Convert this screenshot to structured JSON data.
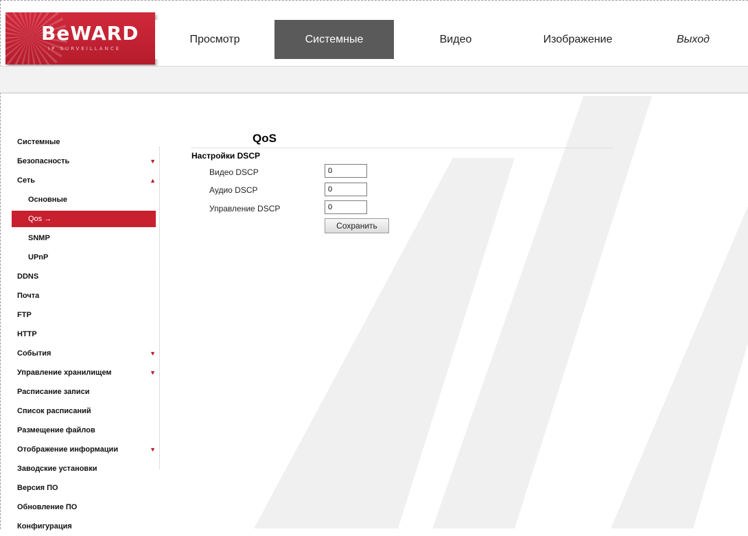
{
  "logo": {
    "main": "BeWARD",
    "sub": "IP SURVEILLANCE"
  },
  "nav": {
    "items": [
      {
        "label": "Просмотр",
        "active": false
      },
      {
        "label": "Системные",
        "active": true
      },
      {
        "label": "Видео",
        "active": false
      },
      {
        "label": "Изображение",
        "active": false
      },
      {
        "label": "Выход",
        "active": false
      }
    ]
  },
  "sidebar": {
    "items": [
      {
        "label": "Системные"
      },
      {
        "label": "Безопасность",
        "arrow": "▼"
      },
      {
        "label": "Сеть",
        "arrow": "▲"
      },
      {
        "label": "Основные"
      },
      {
        "label": "Qos",
        "suffix": "→"
      },
      {
        "label": "SNMP"
      },
      {
        "label": "UPnP"
      },
      {
        "label": "DDNS"
      },
      {
        "label": "Почта"
      },
      {
        "label": "FTP"
      },
      {
        "label": "HTTP"
      },
      {
        "label": "События",
        "arrow": "▼"
      },
      {
        "label": "Управление хранилищем",
        "arrow": "▼"
      },
      {
        "label": "Расписание записи"
      },
      {
        "label": "Список расписаний"
      },
      {
        "label": "Размещение файлов"
      },
      {
        "label": "Отображение информации",
        "arrow": "▼"
      },
      {
        "label": "Заводские установки"
      },
      {
        "label": "Версия ПО"
      },
      {
        "label": "Обновление ПО"
      },
      {
        "label": "Конфигурация"
      }
    ]
  },
  "content": {
    "title": "QoS",
    "section": "Настройки DSCP",
    "fields": [
      {
        "label": "Видео DSCP",
        "value": "0"
      },
      {
        "label": "Аудио DSCP",
        "value": "0"
      },
      {
        "label": "Управление DSCP",
        "value": "0"
      }
    ],
    "save_label": "Сохранить"
  },
  "colors": {
    "brand_red": "#c8202f",
    "active_tab": "#5a5a5a"
  }
}
